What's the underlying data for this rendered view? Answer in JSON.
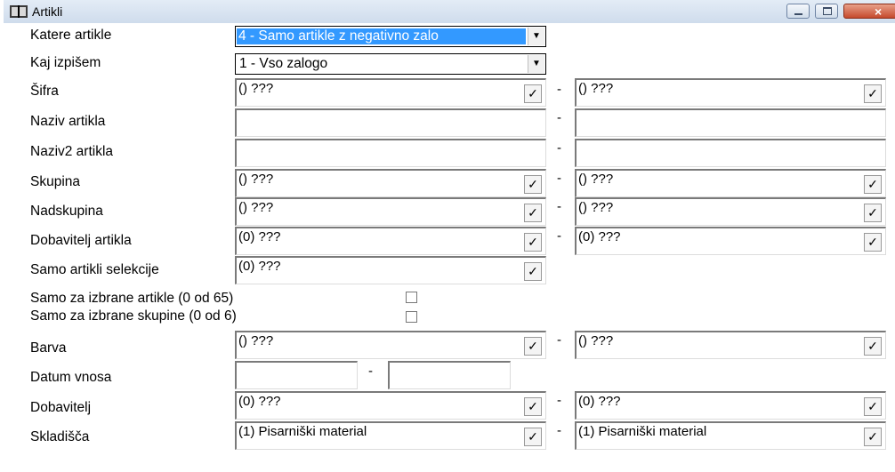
{
  "window": {
    "title": "Artikli",
    "app_icon": "book-icon",
    "close_glyph": "×"
  },
  "combos": {
    "katere": {
      "label": "Katere artikle",
      "value": "4 - Samo artikle z negativno zalo",
      "arrow": "▼"
    },
    "kaj": {
      "label": "Kaj izpišem",
      "value": "1 - Vso zalogo",
      "arrow": "▼"
    }
  },
  "lookup_glyph": "✓",
  "dash": "-",
  "rows": {
    "sifra": {
      "label": "Šifra",
      "from": "() ???",
      "to": "() ???"
    },
    "naziv": {
      "label": "Naziv artikla",
      "from": "",
      "to": ""
    },
    "naziv2": {
      "label": "Naziv2 artikla",
      "from": "",
      "to": ""
    },
    "skupina": {
      "label": "Skupina",
      "from": "() ???",
      "to": "() ???"
    },
    "nadskupina": {
      "label": "Nadskupina",
      "from": "() ???",
      "to": "() ???"
    },
    "dobavitelj_artikla": {
      "label": "Dobavitelj artikla",
      "from": "(0) ???",
      "to": "(0) ???"
    },
    "selekcija": {
      "label": "Samo artikli selekcije",
      "from": "(0) ???"
    },
    "barva": {
      "label": "Barva",
      "from": "() ???",
      "to": "() ???"
    },
    "datum": {
      "label": "Datum vnosa",
      "from": "",
      "to": ""
    },
    "dobavitelj": {
      "label": "Dobavitelj",
      "from": "(0) ???",
      "to": "(0) ???"
    },
    "skladisca": {
      "label": "Skladišča",
      "from": "(1) Pisarniški material",
      "to": "(1) Pisarniški material"
    }
  },
  "checkboxes": {
    "artikle": {
      "label": "Samo za izbrane artikle (0 od 65)",
      "checked": false
    },
    "skupine": {
      "label": "Samo za izbrane skupine (0 od 6)",
      "checked": false
    }
  },
  "colors": {
    "selection": "#3399ff",
    "titlebar": "#dce7f3",
    "close_button": "#c54a2c"
  }
}
